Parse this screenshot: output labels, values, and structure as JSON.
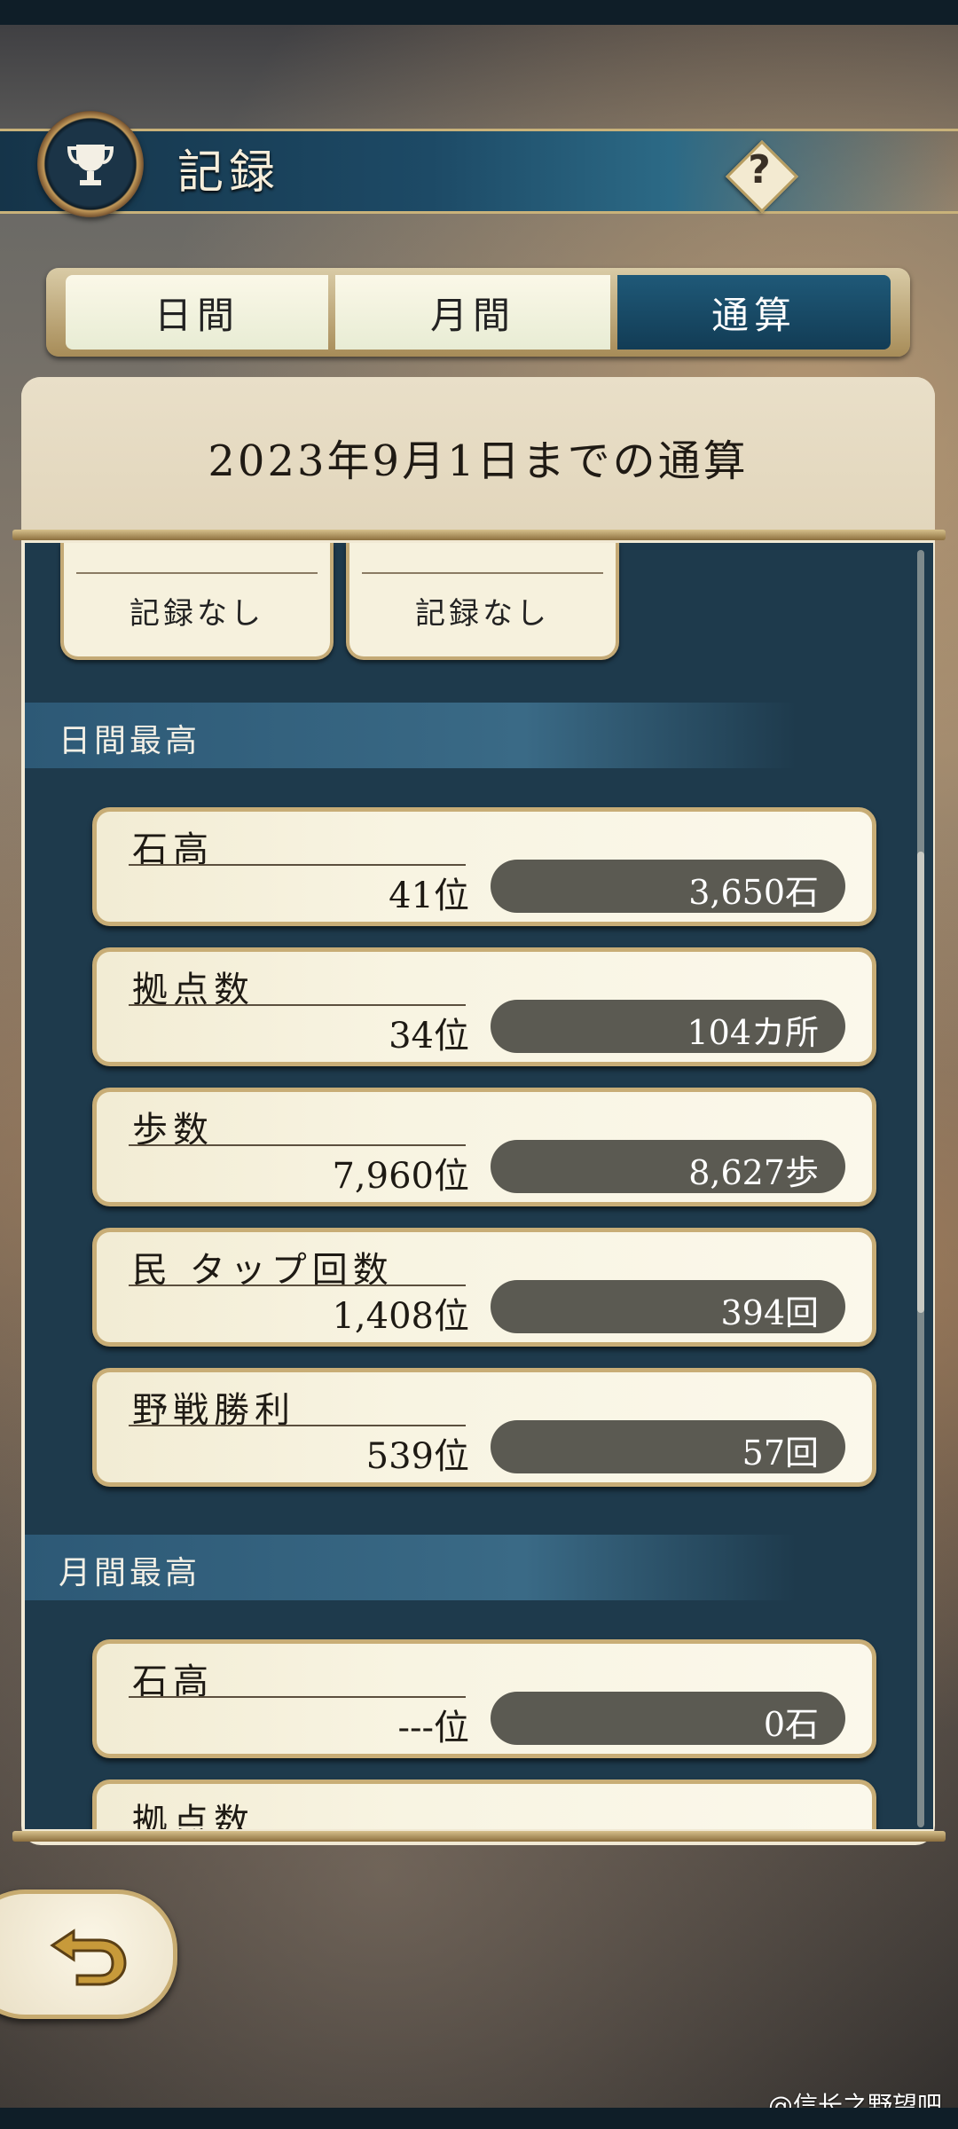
{
  "header": {
    "title": "記録",
    "help_icon": "?"
  },
  "tabs": [
    {
      "label": "日間",
      "active": false
    },
    {
      "label": "月間",
      "active": false
    },
    {
      "label": "通算",
      "active": true
    }
  ],
  "panel": {
    "period_title": "2023年9月1日までの通算"
  },
  "partial_cards": [
    {
      "value": "記録なし"
    },
    {
      "value": "記録なし"
    }
  ],
  "daily_section": {
    "title": "日間最高",
    "items": [
      {
        "label": "石高",
        "rank": "41位",
        "value": "3,650石"
      },
      {
        "label": "拠点数",
        "rank": "34位",
        "value": "104カ所"
      },
      {
        "label": "歩数",
        "rank": "7,960位",
        "value": "8,627歩"
      },
      {
        "label": "民 タップ回数",
        "rank": "1,408位",
        "value": "394回"
      },
      {
        "label": "野戦勝利",
        "rank": "539位",
        "value": "57回"
      }
    ]
  },
  "monthly_section": {
    "title": "月間最高",
    "items": [
      {
        "label": "石高",
        "rank": "---位",
        "value": "0石"
      },
      {
        "label": "拠点数"
      }
    ]
  },
  "watermark": "@信长之野望吧",
  "colors": {
    "accent": "#1f5978",
    "gold": "#c8ad76",
    "pill": "#5b5a52"
  }
}
